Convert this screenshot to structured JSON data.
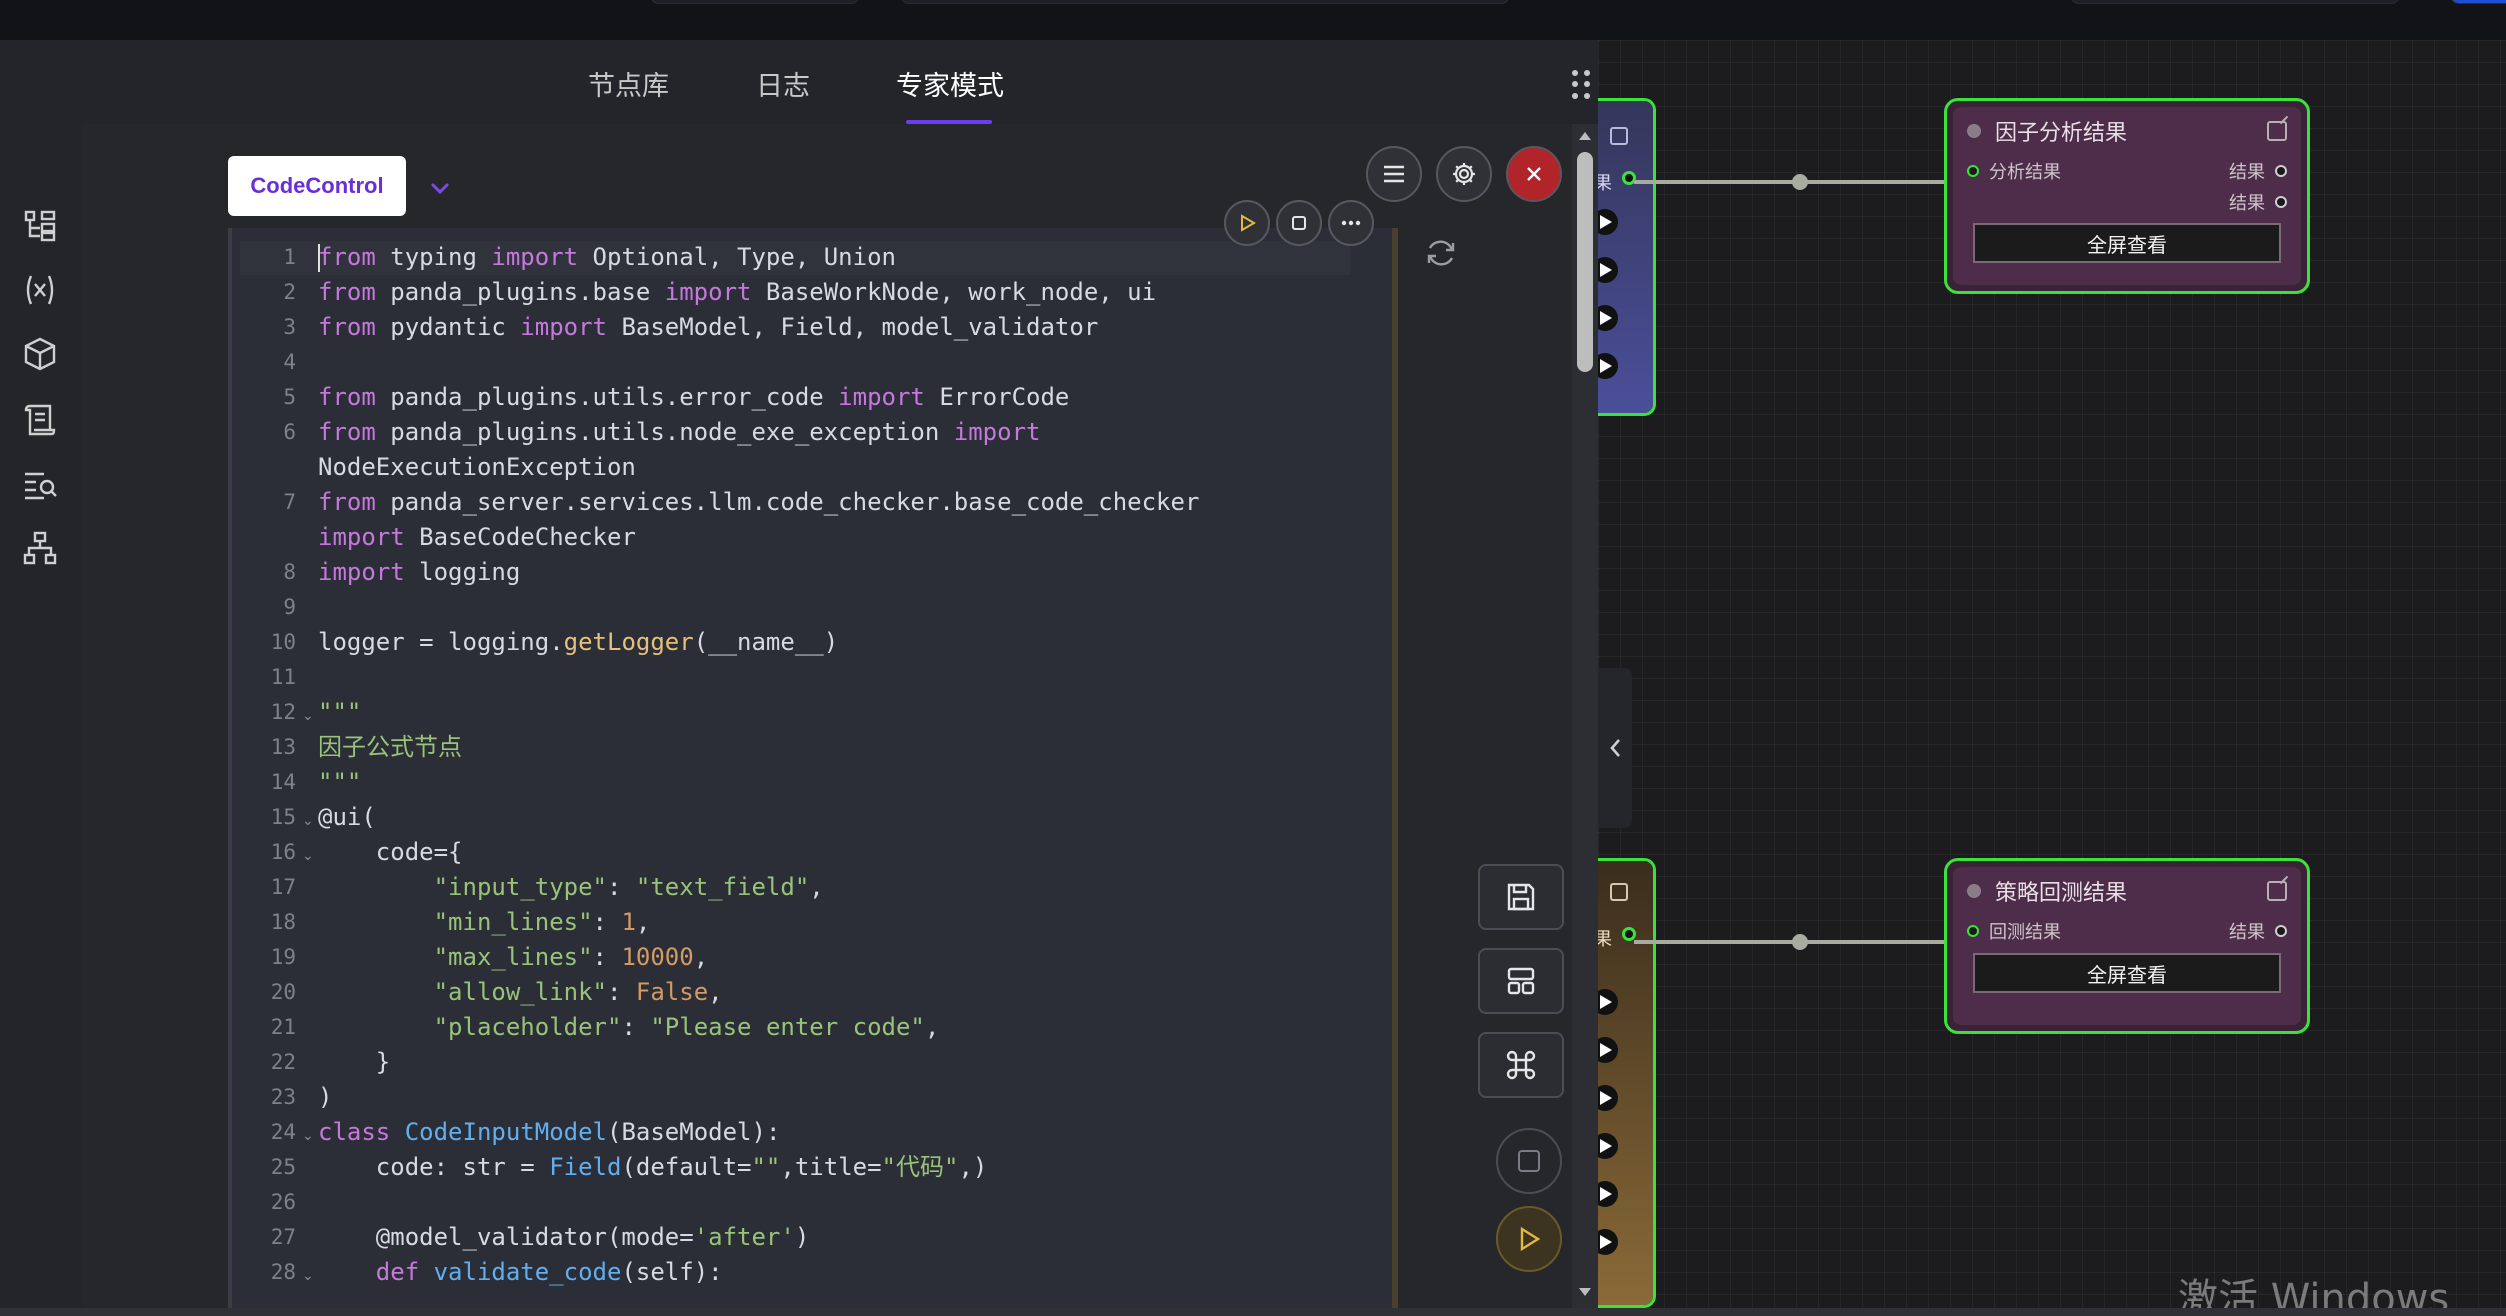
{
  "tabs": [
    {
      "label": "节点库"
    },
    {
      "label": "日志"
    },
    {
      "label": "专家模式"
    }
  ],
  "editor": {
    "mode_button": "CodeControl",
    "line_numbers": [
      "1",
      "2",
      "3",
      "4",
      "5",
      "6",
      "",
      "7",
      "",
      "8",
      "9",
      "10",
      "11",
      "12",
      "13",
      "14",
      "15",
      "16",
      "17",
      "18",
      "19",
      "20",
      "21",
      "22",
      "23",
      "24",
      "25",
      "26",
      "27",
      "28"
    ]
  },
  "canvas": {
    "node_factor": {
      "title": "因子分析结果",
      "input_label": "分析结果",
      "output_1": "结果",
      "output_2": "结果",
      "button": "全屏查看"
    },
    "node_backtest": {
      "title": "策略回测结果",
      "input_label": "回测结果",
      "output_1": "结果",
      "button": "全屏查看"
    },
    "left_node_top_label": "果",
    "left_node_bottom_label": "果",
    "accent_green": "#3ce23c",
    "node_purple": "#4d2d49"
  },
  "watermark": "激活 Windows",
  "icons": {
    "sidebar": [
      "tree-icon",
      "variable-icon",
      "cube-icon",
      "scroll-icon",
      "search-list-icon",
      "hierarchy-icon"
    ]
  }
}
